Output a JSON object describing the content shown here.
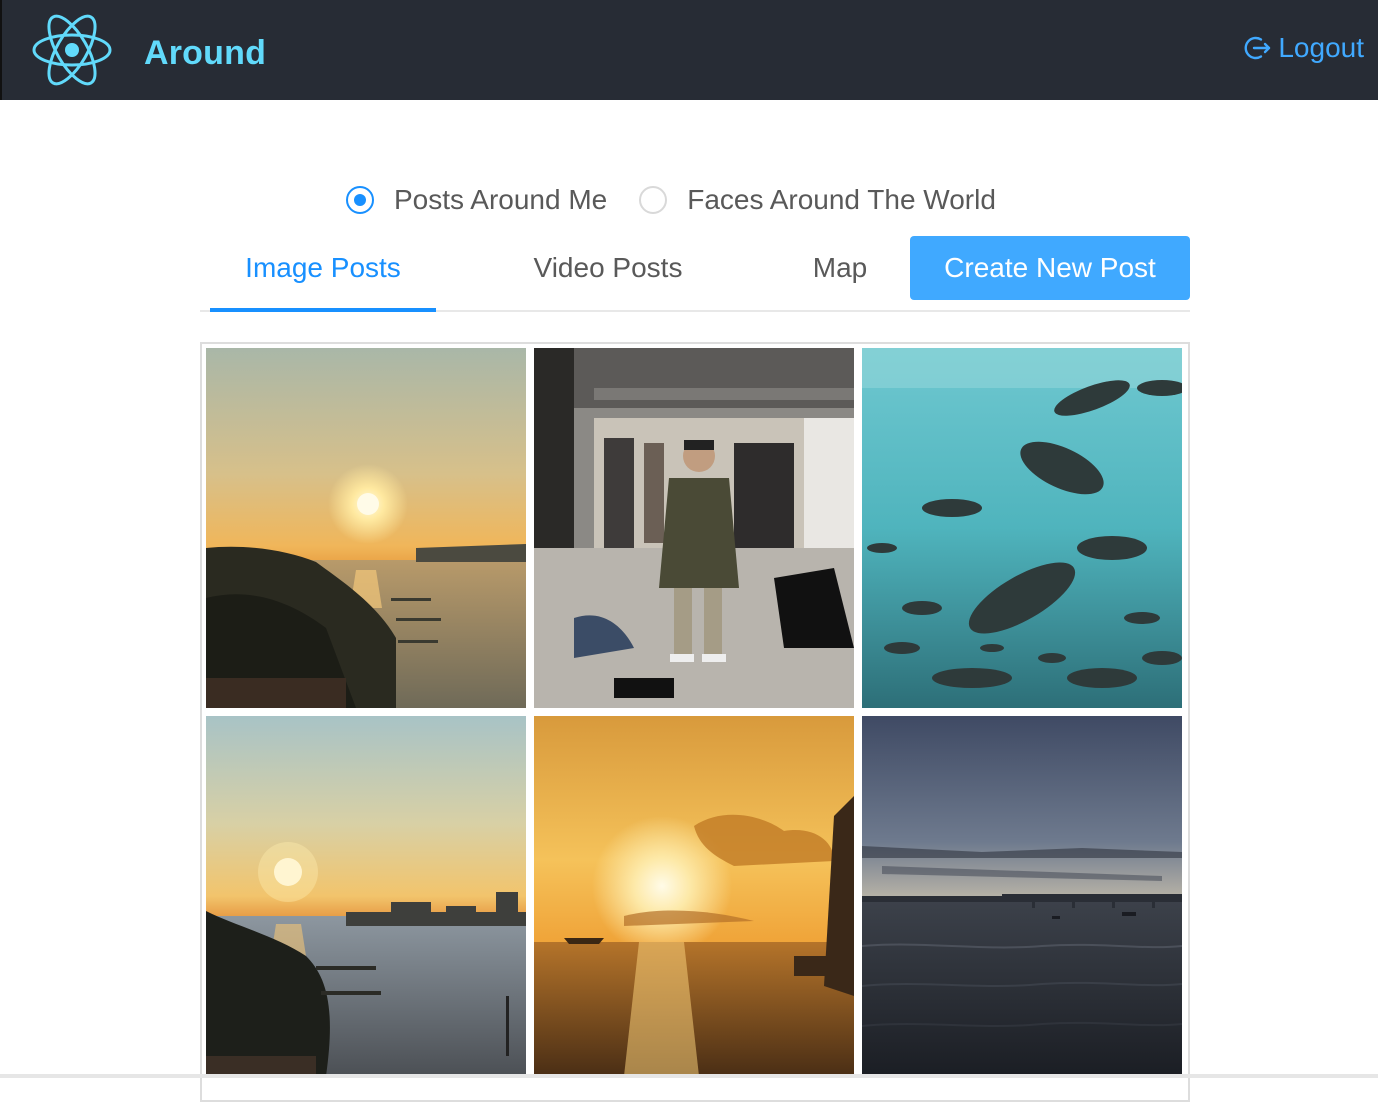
{
  "header": {
    "app_title": "Around",
    "logout_label": "Logout",
    "logo_icon": "react-atom-icon",
    "accent_color": "#61dafb",
    "background_color": "#272c35"
  },
  "topic_selector": {
    "options": [
      {
        "label": "Posts Around Me",
        "selected": true
      },
      {
        "label": "Faces Around The World",
        "selected": false
      }
    ]
  },
  "tabs": {
    "items": [
      {
        "label": "Image Posts",
        "active": true
      },
      {
        "label": "Video Posts",
        "active": false
      },
      {
        "label": "Map",
        "active": false
      }
    ],
    "create_button_label": "Create New Post",
    "active_color": "#1890ff"
  },
  "gallery": {
    "images": [
      {
        "subject": "sunset over bay with docks"
      },
      {
        "subject": "mirror selfie in clothing store"
      },
      {
        "subject": "fish swimming underwater"
      },
      {
        "subject": "sunset over bay with skyline"
      },
      {
        "subject": "golden sunset over sea"
      },
      {
        "subject": "dusk over water with bridge"
      }
    ]
  }
}
